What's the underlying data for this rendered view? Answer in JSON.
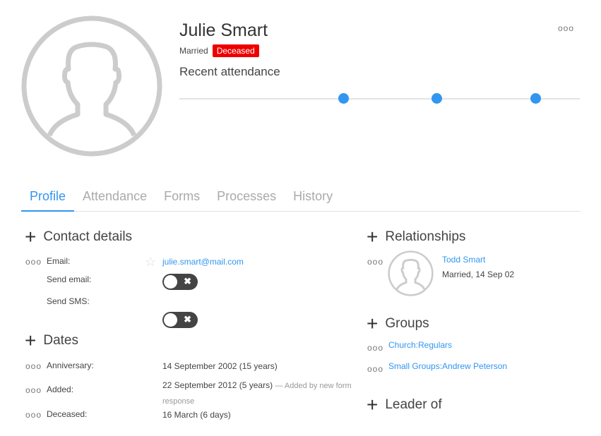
{
  "person": {
    "name": "Julie Smart",
    "marital_status": "Married",
    "badge": "Deceased",
    "badge_color": "#ee0000"
  },
  "attendance": {
    "title": "Recent attendance",
    "dots": 3
  },
  "more_icon": "ooo",
  "tabs": [
    "Profile",
    "Attendance",
    "Forms",
    "Processes",
    "History"
  ],
  "contact": {
    "title": "Contact details",
    "email_label": "Email:",
    "email": "julie.smart@mail.com",
    "send_email_label": "Send email:",
    "send_sms_label": "Send SMS:",
    "send_email": false,
    "send_sms": false
  },
  "dates": {
    "title": "Dates",
    "rows": [
      {
        "label": "Anniversary:",
        "value": "14 September 2002 (15 years)",
        "note": ""
      },
      {
        "label": "Added:",
        "value": "22 September 2012 (5 years)",
        "note": "— Added by new form response"
      },
      {
        "label": "Deceased:",
        "value": "16 March (6 days)",
        "note": ""
      }
    ]
  },
  "relationships": {
    "title": "Relationships",
    "name": "Todd Smart",
    "detail": "Married, 14 Sep 02"
  },
  "groups": {
    "title": "Groups",
    "items": [
      "Church:Regulars",
      "Small Groups:Andrew Peterson"
    ]
  },
  "leader": {
    "title": "Leader of"
  }
}
